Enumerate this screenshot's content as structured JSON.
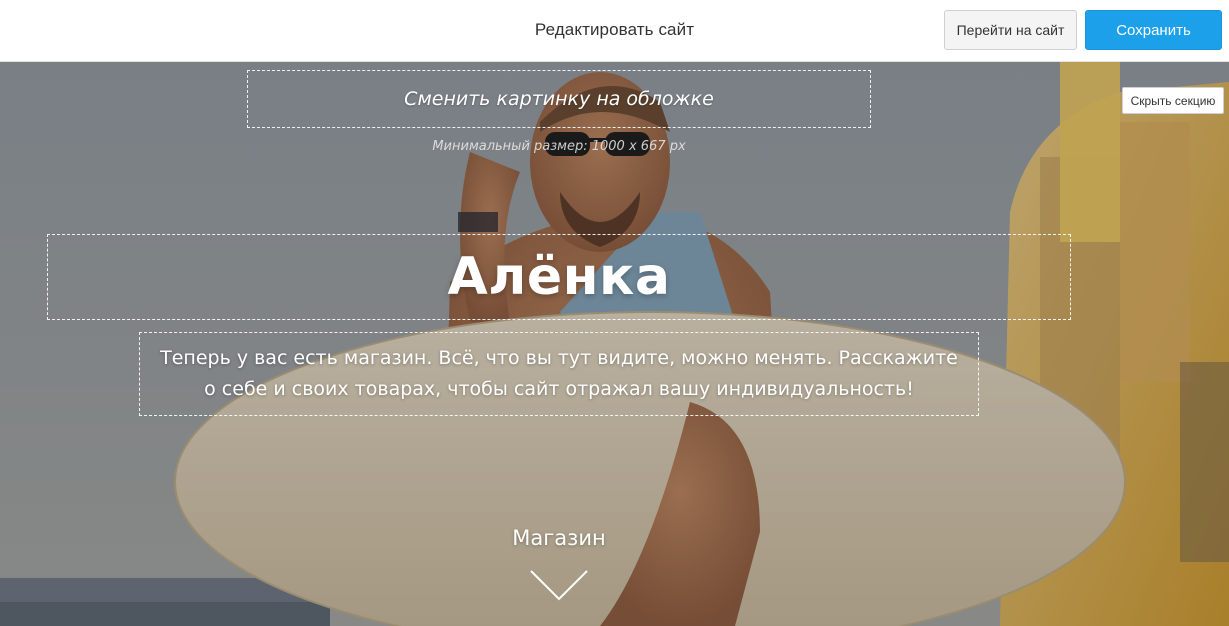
{
  "topbar": {
    "title": "Редактировать сайт",
    "visit_label": "Перейти на сайт",
    "save_label": "Сохранить"
  },
  "hero": {
    "change_cover_label": "Сменить картинку на обложке",
    "min_size_hint": "Минимальный размер: 1000 x 667 px",
    "hide_section_label": "Скрыть секцию",
    "site_title": "Алёнка",
    "description": "Теперь у вас есть магазин. Всё, что вы тут видите, можно менять. Расскажите о себе и своих товарах, чтобы сайт отражал вашу индивидуальность!",
    "shop_link_label": "Магазин",
    "scroll_icon": "chevron-down-icon",
    "cover_photo": "man-with-surfboard-photo"
  },
  "colors": {
    "accent": "#1ba0e9",
    "text_dark": "#333333"
  }
}
